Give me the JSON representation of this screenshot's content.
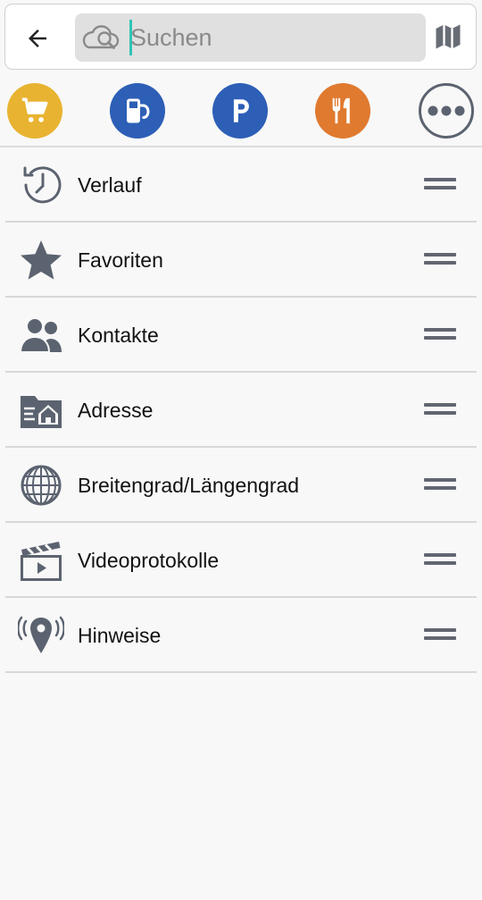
{
  "search": {
    "placeholder": "Suchen",
    "value": ""
  },
  "icons": {
    "back": "arrow-left-icon",
    "cloud": "cloud-search-icon",
    "map": "map-icon"
  },
  "categories": [
    {
      "name": "shopping-cart-icon",
      "color": "#e8b330"
    },
    {
      "name": "fuel-station-icon",
      "color": "#2d5fb6"
    },
    {
      "name": "parking-icon",
      "color": "#2d5fb6"
    },
    {
      "name": "restaurant-icon",
      "color": "#e07a2f"
    },
    {
      "name": "more-icon",
      "color": "#5c6370"
    }
  ],
  "menu": {
    "items": [
      {
        "label": "Verlauf",
        "icon": "history-clock-icon"
      },
      {
        "label": "Favoriten",
        "icon": "star-icon"
      },
      {
        "label": "Kontakte",
        "icon": "contacts-icon"
      },
      {
        "label": "Adresse",
        "icon": "address-folder-icon"
      },
      {
        "label": "Breitengrad/Längengrad",
        "icon": "globe-icon"
      },
      {
        "label": "Videoprotokolle",
        "icon": "clapperboard-icon"
      },
      {
        "label": "Hinweise",
        "icon": "location-broadcast-icon"
      }
    ]
  },
  "colors": {
    "icon_gray": "#5c6370",
    "caret": "#2ec4b6",
    "cart": "#e8b330",
    "fuel": "#2d5fb6",
    "parking": "#2d5fb6",
    "food": "#e07a2f"
  }
}
